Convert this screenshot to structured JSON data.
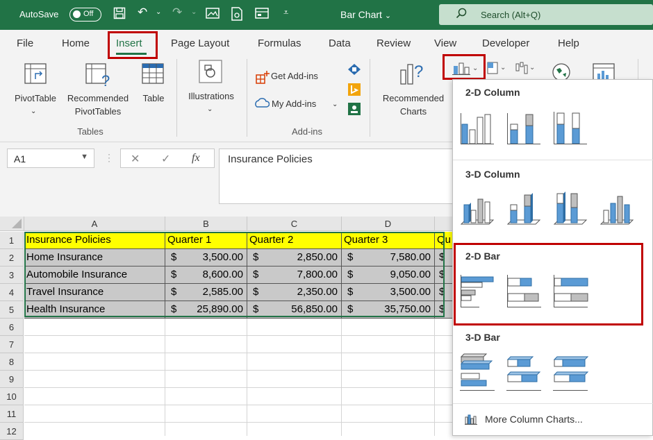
{
  "titlebar": {
    "autosave_label": "AutoSave",
    "toggle_state": "Off",
    "document_title": "Bar Chart",
    "search_placeholder": "Search (Alt+Q)"
  },
  "tabs": [
    "File",
    "Home",
    "Insert",
    "Page Layout",
    "Formulas",
    "Data",
    "Review",
    "View",
    "Developer",
    "Help"
  ],
  "active_tab": "Insert",
  "ribbon": {
    "pivottable": "PivotTable",
    "recommended_pivot_1": "Recommended",
    "recommended_pivot_2": "PivotTables",
    "table": "Table",
    "tables_group": "Tables",
    "illustrations": "Illustrations",
    "get_addins": "Get Add-ins",
    "my_addins": "My Add-ins",
    "addins_group": "Add-ins",
    "recommended_charts_1": "Recommended",
    "recommended_charts_2": "Charts"
  },
  "formula_bar": {
    "name_box": "A1",
    "cancel_symbol": "✕",
    "enter_symbol": "✓",
    "fx_symbol": "fx",
    "content": "Insurance Policies"
  },
  "sheet": {
    "columns": [
      "A",
      "B",
      "C",
      "D"
    ],
    "row_numbers": [
      "1",
      "2",
      "3",
      "4",
      "5",
      "6",
      "7",
      "8",
      "9",
      "10",
      "11",
      "12"
    ],
    "header": [
      "Insurance Policies",
      "Quarter 1",
      "Quarter 2",
      "Quarter 3",
      "Qu"
    ],
    "rows": [
      {
        "name": "Home Insurance",
        "q1": "3,500.00",
        "q2": "2,850.00",
        "q3": "7,580.00"
      },
      {
        "name": "Automobile Insurance",
        "q1": "8,600.00",
        "q2": "7,800.00",
        "q3": "9,050.00"
      },
      {
        "name": "Travel Insurance",
        "q1": "2,585.00",
        "q2": "2,350.00",
        "q3": "3,500.00"
      },
      {
        "name": "Health Insurance",
        "q1": "25,890.00",
        "q2": "56,850.00",
        "q3": "35,750.00"
      }
    ],
    "currency": "$"
  },
  "chart_menu": {
    "section_2d_column": "2-D Column",
    "section_3d_column": "3-D Column",
    "section_2d_bar": "2-D Bar",
    "section_3d_bar": "3-D Bar",
    "more_link": "More Column Charts..."
  },
  "colors": {
    "excel_green": "#217346",
    "highlight_red": "#c00000",
    "chart_blue": "#5b9bd5",
    "chart_gray": "#bfbfbf",
    "header_yellow": "#ffff00",
    "data_gray": "#c9c9c9"
  }
}
